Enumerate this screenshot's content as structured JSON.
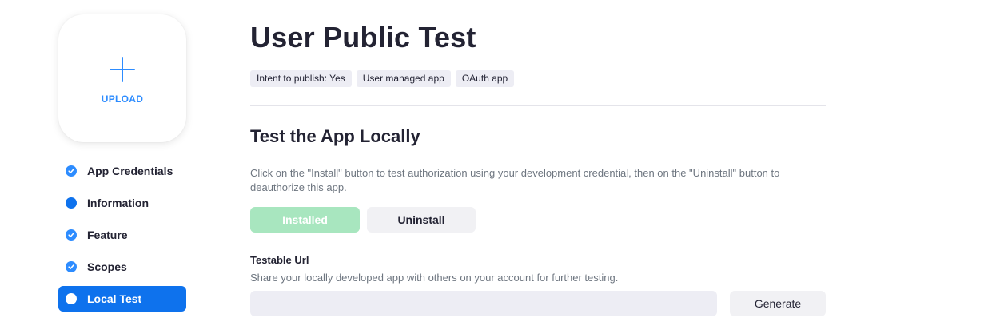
{
  "upload": {
    "label": "UPLOAD"
  },
  "nav": {
    "items": [
      {
        "label": "App Credentials",
        "status": "completed"
      },
      {
        "label": "Information",
        "status": "incomplete"
      },
      {
        "label": "Feature",
        "status": "completed"
      },
      {
        "label": "Scopes",
        "status": "completed"
      },
      {
        "label": "Local Test",
        "status": "current"
      }
    ]
  },
  "header": {
    "title": "User Public Test",
    "tags": [
      "Intent to publish: Yes",
      "User managed app",
      "OAuth app"
    ]
  },
  "local_test": {
    "title": "Test the App Locally",
    "description": "Click on the \"Install\" button to test authorization using your development credential, then on the \"Uninstall\" button to deauthorize this app.",
    "installed_label": "Installed",
    "uninstall_label": "Uninstall"
  },
  "testable_url": {
    "label": "Testable Url",
    "description": "Share your locally developed app with others on your account for further testing.",
    "value": "",
    "generate_label": "Generate"
  },
  "colors": {
    "accent": "#0e72ed",
    "accent_light": "#2d8cff",
    "installed_green": "#a8e6bf"
  }
}
